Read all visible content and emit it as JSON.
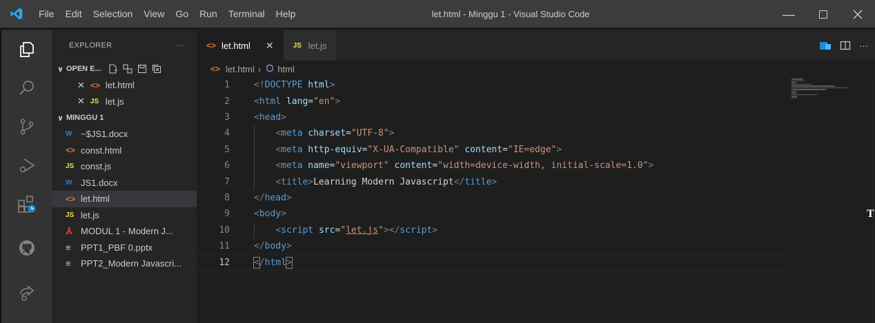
{
  "menu": [
    "File",
    "Edit",
    "Selection",
    "View",
    "Go",
    "Run",
    "Terminal",
    "Help"
  ],
  "window_title": "let.html - Minggu 1 - Visual Studio Code",
  "explorer": {
    "title": "EXPLORER",
    "more": "···",
    "open_editors_label": "OPEN E...",
    "open_editors": [
      {
        "icon": "html",
        "name": "let.html"
      },
      {
        "icon": "js",
        "name": "let.js"
      }
    ],
    "folder_label": "MINGGU 1",
    "files": [
      {
        "icon": "docx",
        "name": "~$JS1.docx"
      },
      {
        "icon": "html",
        "name": "const.html"
      },
      {
        "icon": "js",
        "name": "const.js"
      },
      {
        "icon": "docx",
        "name": "JS1.docx"
      },
      {
        "icon": "html",
        "name": "let.html",
        "selected": true
      },
      {
        "icon": "js",
        "name": "let.js"
      },
      {
        "icon": "pdf",
        "name": "MODUL 1 - Modern J..."
      },
      {
        "icon": "txt",
        "name": "PPT1_PBF 0.pptx"
      },
      {
        "icon": "txt",
        "name": "PPT2_Modern Javascri..."
      }
    ]
  },
  "tabs": [
    {
      "name": "let.html",
      "active": true
    },
    {
      "name": "let.js",
      "active": false
    }
  ],
  "breadcrumb": {
    "file": "let.html",
    "symbol": "html"
  },
  "editor": {
    "current_line": 12,
    "lines": [
      [
        [
          "tg",
          "<!"
        ],
        [
          "tn",
          "DOCTYPE"
        ],
        [
          "tx",
          " "
        ],
        [
          "an",
          "html"
        ],
        [
          "tg",
          ">"
        ]
      ],
      [
        [
          "tg",
          "<"
        ],
        [
          "tn",
          "html"
        ],
        [
          "tx",
          " "
        ],
        [
          "an",
          "lang"
        ],
        [
          "tx",
          "="
        ],
        [
          "av",
          "\"en\""
        ],
        [
          "tg",
          ">"
        ]
      ],
      [
        [
          "tg",
          "<"
        ],
        [
          "tn",
          "head"
        ],
        [
          "tg",
          ">"
        ]
      ],
      [
        [
          "tx",
          "    "
        ],
        [
          "tg",
          "<"
        ],
        [
          "tn",
          "meta"
        ],
        [
          "tx",
          " "
        ],
        [
          "an",
          "charset"
        ],
        [
          "tx",
          "="
        ],
        [
          "av",
          "\"UTF-8\""
        ],
        [
          "tg",
          ">"
        ]
      ],
      [
        [
          "tx",
          "    "
        ],
        [
          "tg",
          "<"
        ],
        [
          "tn",
          "meta"
        ],
        [
          "tx",
          " "
        ],
        [
          "an",
          "http-equiv"
        ],
        [
          "tx",
          "="
        ],
        [
          "av",
          "\"X-UA-Compatible\""
        ],
        [
          "tx",
          " "
        ],
        [
          "an",
          "content"
        ],
        [
          "tx",
          "="
        ],
        [
          "av",
          "\"IE=edge\""
        ],
        [
          "tg",
          ">"
        ]
      ],
      [
        [
          "tx",
          "    "
        ],
        [
          "tg",
          "<"
        ],
        [
          "tn",
          "meta"
        ],
        [
          "tx",
          " "
        ],
        [
          "an",
          "name"
        ],
        [
          "tx",
          "="
        ],
        [
          "av",
          "\"viewport\""
        ],
        [
          "tx",
          " "
        ],
        [
          "an",
          "content"
        ],
        [
          "tx",
          "="
        ],
        [
          "av",
          "\"width=device-width, initial-scale=1.0\""
        ],
        [
          "tg",
          ">"
        ]
      ],
      [
        [
          "tx",
          "    "
        ],
        [
          "tg",
          "<"
        ],
        [
          "tn",
          "title"
        ],
        [
          "tg",
          ">"
        ],
        [
          "tx",
          "Learning Modern Javascript"
        ],
        [
          "tg",
          "</"
        ],
        [
          "tn",
          "title"
        ],
        [
          "tg",
          ">"
        ]
      ],
      [
        [
          "tg",
          "</"
        ],
        [
          "tn",
          "head"
        ],
        [
          "tg",
          ">"
        ]
      ],
      [
        [
          "tg",
          "<"
        ],
        [
          "tn",
          "body"
        ],
        [
          "tg",
          ">"
        ]
      ],
      [
        [
          "tx",
          "    "
        ],
        [
          "tg",
          "<"
        ],
        [
          "tn",
          "script"
        ],
        [
          "tx",
          " "
        ],
        [
          "an",
          "src"
        ],
        [
          "tx",
          "="
        ],
        [
          "av",
          "\""
        ],
        [
          "avul",
          "let.js"
        ],
        [
          "av",
          "\""
        ],
        [
          "tg",
          "></"
        ],
        [
          "tn",
          "script"
        ],
        [
          "tg",
          ">"
        ]
      ],
      [
        [
          "tg",
          "</"
        ],
        [
          "tn",
          "body"
        ],
        [
          "tg",
          ">"
        ]
      ],
      [
        [
          "tgbm",
          "<"
        ],
        [
          "tg",
          "/"
        ],
        [
          "tn",
          "html"
        ],
        [
          "tgbm",
          ">"
        ]
      ]
    ]
  },
  "colors": {
    "titlebar": "#3c3c3c",
    "activitybar": "#333333",
    "sidebar": "#252526",
    "editor": "#1e1e1e",
    "vscode_blue": "#23a9f2"
  }
}
